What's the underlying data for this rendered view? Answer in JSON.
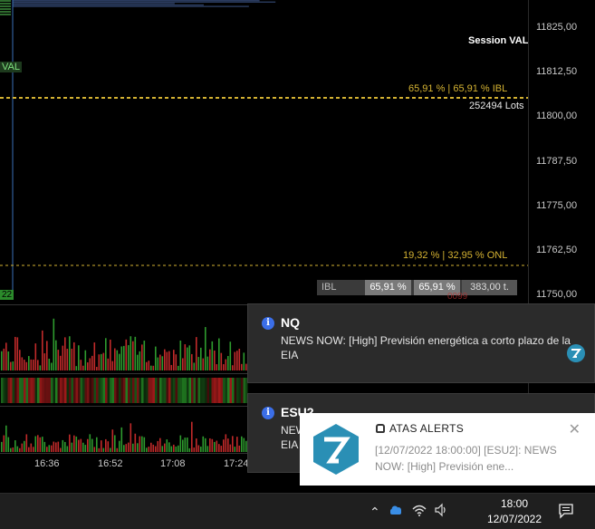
{
  "price_axis": {
    "ticks": [
      "11825,00",
      "11812,50",
      "11800,00",
      "11787,50",
      "11775,00",
      "11762,50",
      "11750,00"
    ]
  },
  "chart": {
    "session_val": "Session VAL",
    "val_tag": "VAL",
    "ibl_label": "65,91 % | 65,91 % IBL",
    "lots_label": "252494 Lots",
    "onl_label": "19,32 % | 32,95 % ONL",
    "bottom_green_tag": "22",
    "faded_value": "0099",
    "ibl_bar": {
      "name": "IBL",
      "pct1": "65,91 %",
      "pct2": "65,91 %",
      "value": "383,00 t."
    },
    "colors": {
      "ibl_line": "#d4b232",
      "onl_line": "#d4b232",
      "session_line": "#3a6fb8",
      "up_bar": "#2e9b2e",
      "down_bar": "#c02a2a"
    }
  },
  "time_axis": {
    "labels": [
      "16:36",
      "16:52",
      "17:08",
      "17:24"
    ]
  },
  "toasts": [
    {
      "symbol": "NQ",
      "body": "NEWS NOW: [High] Previsión energética a corto plazo de la EIA"
    },
    {
      "symbol": "ESU2",
      "body": "NEWS NOW: [High] Previsión energética a corto plazo de la EIA"
    }
  ],
  "alert": {
    "title": "ATAS ALERTS",
    "close_symbol": "✕",
    "body": "[12/07/2022 18:00:00] [ESU2]: NEWS NOW: [High] Previsión ene..."
  },
  "taskbar": {
    "time": "18:00",
    "date": "12/07/2022",
    "icons": [
      "chevron-up-icon",
      "cloud-icon",
      "wifi-icon",
      "speaker-icon",
      "notification-icon"
    ]
  }
}
